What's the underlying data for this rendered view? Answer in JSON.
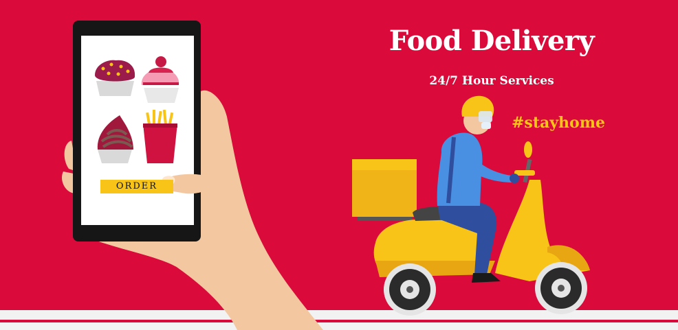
{
  "banner": {
    "title": "Food Delivery",
    "subtitle": "24/7 Hour Services",
    "hashtag": "#stayhome"
  },
  "phone": {
    "order_label": "ORDER",
    "menu_items": [
      "cupcake-icon",
      "frosted-cupcake-icon",
      "swirl-dessert-icon",
      "french-fries-icon"
    ]
  },
  "colors": {
    "background": "#da0a3b",
    "accent": "#f7c417",
    "text": "#ffffff",
    "road": "#f2f2f2"
  }
}
